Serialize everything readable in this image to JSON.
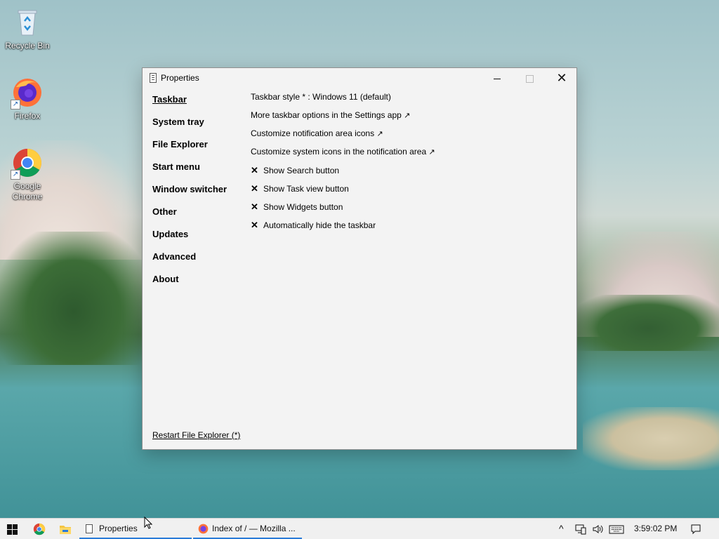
{
  "desktop": {
    "icons": [
      {
        "label": "Recycle Bin",
        "icon": "recycle-bin-icon"
      },
      {
        "label": "Firefox",
        "icon": "firefox-icon"
      },
      {
        "label": "Google Chrome",
        "icon": "chrome-icon"
      }
    ]
  },
  "window": {
    "title": "Properties",
    "nav": [
      {
        "label": "Taskbar",
        "active": true
      },
      {
        "label": "System tray"
      },
      {
        "label": "File Explorer"
      },
      {
        "label": "Start menu"
      },
      {
        "label": "Window switcher"
      },
      {
        "label": "Other"
      },
      {
        "label": "Updates"
      },
      {
        "label": "Advanced"
      },
      {
        "label": "About"
      }
    ],
    "settings": {
      "taskbar_style": "Taskbar style * : Windows 11 (default)",
      "more_options": "More taskbar options in the Settings app",
      "notif_icons": "Customize notification area icons",
      "system_icons": "Customize system icons in the notification area",
      "link_arrow": "↗",
      "check_mark": "✕",
      "show_search": "Show Search button",
      "show_taskview": "Show Task view button",
      "show_widgets": "Show Widgets button",
      "autohide": "Automatically hide the taskbar"
    },
    "restart_link": "Restart File Explorer (*)"
  },
  "taskbar": {
    "properties_label": "Properties",
    "firefox_label": "Index of / — Mozilla ...",
    "clock": "3:59:02 PM",
    "accent": "#2a7bd8"
  }
}
